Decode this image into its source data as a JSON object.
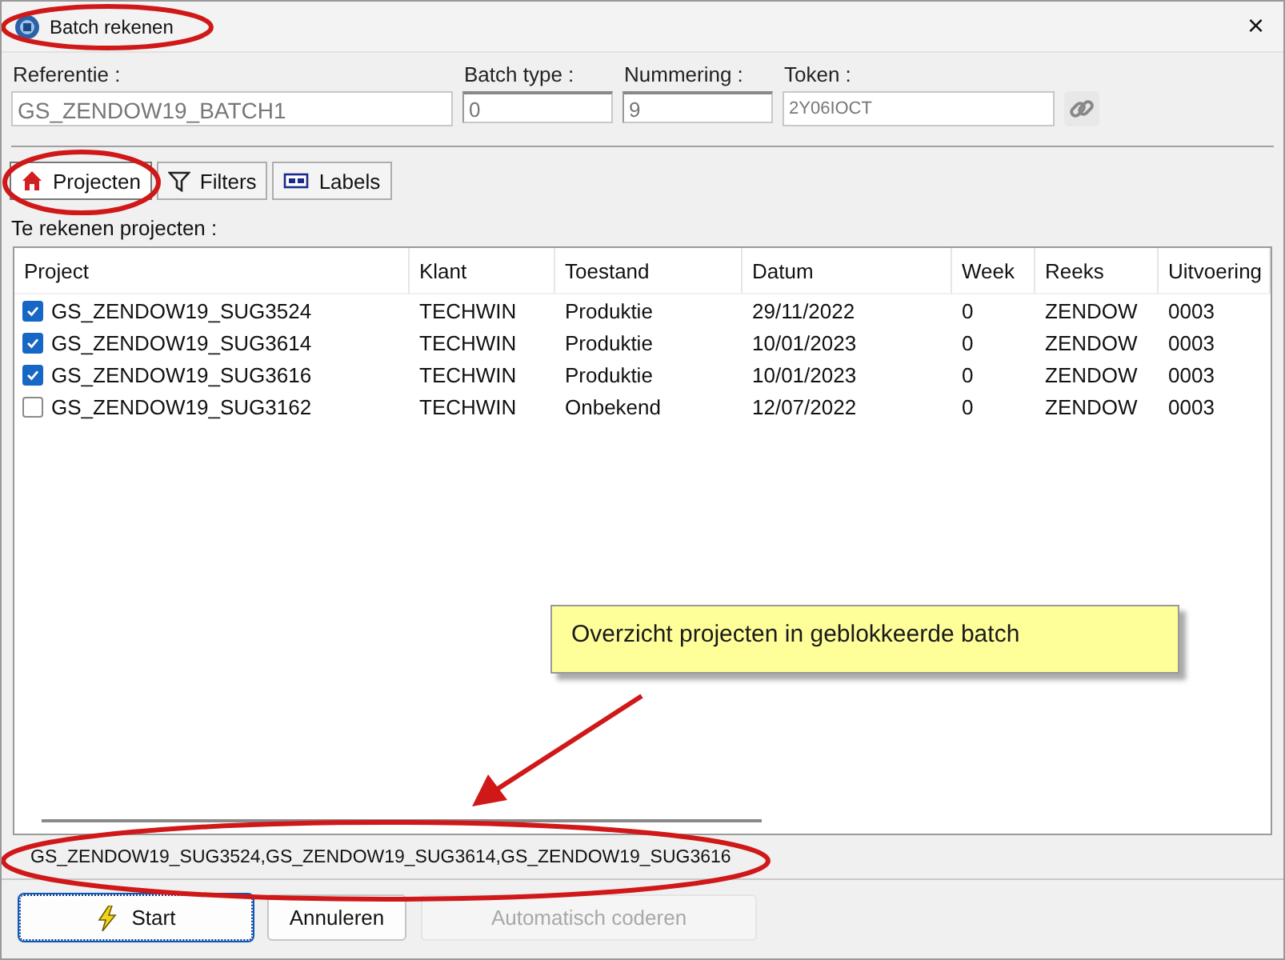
{
  "window": {
    "title": "Batch rekenen",
    "close": "×"
  },
  "fields": [
    {
      "label": "Referentie :",
      "value": "GS_ZENDOW19_BATCH1",
      "kind": "wide"
    },
    {
      "label": "Batch type :",
      "value": "0",
      "kind": "narrow"
    },
    {
      "label": "Nummering :",
      "value": "9",
      "kind": "narrow"
    },
    {
      "label": "Token :",
      "value": "2Y06IOCT",
      "kind": "token"
    }
  ],
  "tabs": [
    {
      "label": "Projecten",
      "selected": true,
      "kind": "home"
    },
    {
      "label": "Filters",
      "selected": false,
      "kind": "filter"
    },
    {
      "label": "Labels",
      "selected": false,
      "kind": "label"
    }
  ],
  "list_label": "Te rekenen projecten :",
  "table": {
    "columns": [
      "Project",
      "Klant",
      "Toestand",
      "Datum",
      "Week",
      "Reeks",
      "Uitvoering"
    ],
    "rows": [
      {
        "checked": true,
        "cells": [
          "GS_ZENDOW19_SUG3524",
          "TECHWIN",
          "Produktie",
          "29/11/2022",
          "0",
          "ZENDOW",
          "0003"
        ]
      },
      {
        "checked": true,
        "cells": [
          "GS_ZENDOW19_SUG3614",
          "TECHWIN",
          "Produktie",
          "10/01/2023",
          "0",
          "ZENDOW",
          "0003"
        ]
      },
      {
        "checked": true,
        "cells": [
          "GS_ZENDOW19_SUG3616",
          "TECHWIN",
          "Produktie",
          "10/01/2023",
          "0",
          "ZENDOW",
          "0003"
        ]
      },
      {
        "checked": false,
        "cells": [
          "GS_ZENDOW19_SUG3162",
          "TECHWIN",
          "Onbekend",
          "12/07/2022",
          "0",
          "ZENDOW",
          "0003"
        ]
      }
    ]
  },
  "selection": "GS_ZENDOW19_SUG3524,GS_ZENDOW19_SUG3614,GS_ZENDOW19_SUG3616",
  "buttons": [
    {
      "label": "Start",
      "kind": "start",
      "disabled": false
    },
    {
      "label": "Annuleren",
      "kind": "plain",
      "disabled": false
    },
    {
      "label": "Automatisch coderen",
      "kind": "plain",
      "disabled": true
    }
  ],
  "annotation": {
    "text": "Overzicht projecten in geblokkeerde batch"
  }
}
